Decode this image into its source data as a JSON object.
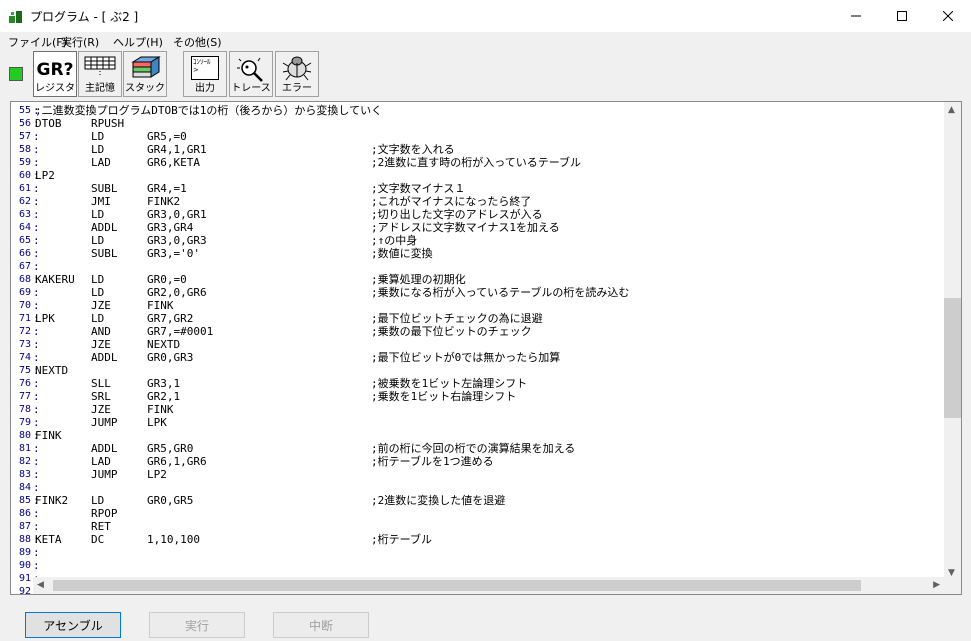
{
  "window": {
    "title": "プログラム - [ ぶ2 ]"
  },
  "menu": [
    {
      "label": "ファイル(F)"
    },
    {
      "label": "実行(R)"
    },
    {
      "label": "ヘルプ(H)"
    },
    {
      "label": "その他(S)"
    }
  ],
  "toolbar": {
    "register": {
      "label": "レジスタ",
      "icon_text": "GR?"
    },
    "memory": {
      "label": "主記憶"
    },
    "stack": {
      "label": "スタック"
    },
    "output": {
      "label": "出力",
      "icon_text": "ｺﾝｿｰﾙ\n>"
    },
    "trace": {
      "label": "トレース"
    },
    "error": {
      "label": "エラー"
    }
  },
  "code_lines": [
    {
      "n": "55",
      "label": ";二進数変換プログラムDTOBでは1の桁（後ろから）から変換していく",
      "op": "",
      "arg": "",
      "cmt": ""
    },
    {
      "n": "56",
      "label": "DTOB",
      "op": "RPUSH",
      "arg": "",
      "cmt": ""
    },
    {
      "n": "57",
      "label": "",
      "op": "LD",
      "arg": "GR5,=0",
      "cmt": ""
    },
    {
      "n": "58",
      "label": "",
      "op": "LD",
      "arg": "GR4,1,GR1",
      "cmt": ";文字数を入れる"
    },
    {
      "n": "59",
      "label": "",
      "op": "LAD",
      "arg": "GR6,KETA",
      "cmt": ";2進数に直す時の桁が入っているテーブル"
    },
    {
      "n": "60",
      "label": "LP2",
      "op": "",
      "arg": "",
      "cmt": ""
    },
    {
      "n": "61",
      "label": "",
      "op": "SUBL",
      "arg": "GR4,=1",
      "cmt": ";文字数マイナス１"
    },
    {
      "n": "62",
      "label": "",
      "op": "JMI",
      "arg": "FINK2",
      "cmt": ";これがマイナスになったら終了"
    },
    {
      "n": "63",
      "label": "",
      "op": "LD",
      "arg": "GR3,0,GR1",
      "cmt": ";切り出した文字のアドレスが入る"
    },
    {
      "n": "64",
      "label": "",
      "op": "ADDL",
      "arg": "GR3,GR4",
      "cmt": ";アドレスに文字数マイナス1を加える"
    },
    {
      "n": "65",
      "label": "",
      "op": "LD",
      "arg": "GR3,0,GR3",
      "cmt": ";↑の中身"
    },
    {
      "n": "66",
      "label": "",
      "op": "SUBL",
      "arg": "GR3,='0'",
      "cmt": ";数値に変換"
    },
    {
      "n": "67",
      "label": "",
      "op": "",
      "arg": "",
      "cmt": ""
    },
    {
      "n": "68",
      "label": "KAKERU",
      "op": "LD",
      "arg": "GR0,=0",
      "cmt": ";乗算処理の初期化"
    },
    {
      "n": "69",
      "label": "",
      "op": "LD",
      "arg": "GR2,0,GR6",
      "cmt": ";乗数になる桁が入っているテーブルの桁を読み込む"
    },
    {
      "n": "70",
      "label": "",
      "op": "JZE",
      "arg": "FINK",
      "cmt": ""
    },
    {
      "n": "71",
      "label": "LPK",
      "op": "LD",
      "arg": "GR7,GR2",
      "cmt": ";最下位ビットチェックの為に退避"
    },
    {
      "n": "72",
      "label": "",
      "op": "AND",
      "arg": "GR7,=#0001",
      "cmt": ";乗数の最下位ビットのチェック"
    },
    {
      "n": "73",
      "label": "",
      "op": "JZE",
      "arg": "NEXTD",
      "cmt": ""
    },
    {
      "n": "74",
      "label": "",
      "op": "ADDL",
      "arg": "GR0,GR3",
      "cmt": ";最下位ビットが0では無かったら加算"
    },
    {
      "n": "75",
      "label": "NEXTD",
      "op": "",
      "arg": "",
      "cmt": ""
    },
    {
      "n": "76",
      "label": "",
      "op": "SLL",
      "arg": "GR3,1",
      "cmt": ";被乗数を1ビット左論理シフト"
    },
    {
      "n": "77",
      "label": "",
      "op": "SRL",
      "arg": "GR2,1",
      "cmt": ";乗数を1ビット右論理シフト"
    },
    {
      "n": "78",
      "label": "",
      "op": "JZE",
      "arg": "FINK",
      "cmt": ""
    },
    {
      "n": "79",
      "label": "",
      "op": "JUMP",
      "arg": "LPK",
      "cmt": ""
    },
    {
      "n": "80",
      "label": "FINK",
      "op": "",
      "arg": "",
      "cmt": ""
    },
    {
      "n": "81",
      "label": "",
      "op": "ADDL",
      "arg": "GR5,GR0",
      "cmt": ";前の桁に今回の桁での演算結果を加える"
    },
    {
      "n": "82",
      "label": "",
      "op": "LAD",
      "arg": "GR6,1,GR6",
      "cmt": ";桁テーブルを1つ進める"
    },
    {
      "n": "83",
      "label": "",
      "op": "JUMP",
      "arg": "LP2",
      "cmt": ""
    },
    {
      "n": "84",
      "label": "",
      "op": "",
      "arg": "",
      "cmt": ""
    },
    {
      "n": "85",
      "label": "FINK2",
      "op": "LD",
      "arg": "GR0,GR5",
      "cmt": ";2進数に変換した値を退避"
    },
    {
      "n": "86",
      "label": "",
      "op": "RPOP",
      "arg": "",
      "cmt": ""
    },
    {
      "n": "87",
      "label": "",
      "op": "RET",
      "arg": "",
      "cmt": ""
    },
    {
      "n": "88",
      "label": "KETA",
      "op": "DC",
      "arg": "1,10,100",
      "cmt": ";桁テーブル"
    },
    {
      "n": "89",
      "label": "",
      "op": "",
      "arg": "",
      "cmt": ""
    },
    {
      "n": "90",
      "label": "",
      "op": "",
      "arg": "",
      "cmt": ""
    },
    {
      "n": "91",
      "label": "",
      "op": "",
      "arg": "",
      "cmt": ""
    },
    {
      "n": "92",
      "label": "",
      "op": "",
      "arg": "",
      "cmt": ""
    }
  ],
  "buttons": {
    "assemble": "アセンブル",
    "run": "実行",
    "stop": "中断"
  },
  "colors": {
    "indicator": "#22cc22",
    "line_number": "#00008b"
  }
}
